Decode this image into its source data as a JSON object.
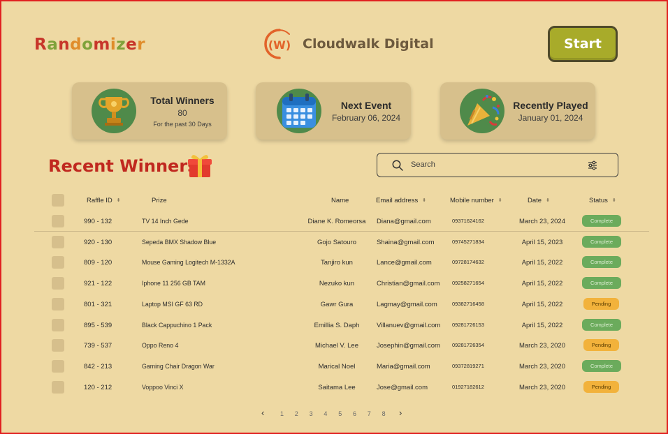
{
  "header": {
    "app_name_letters": [
      {
        "ch": "R",
        "color": "#c7362a"
      },
      {
        "ch": "a",
        "color": "#7fa23a"
      },
      {
        "ch": "n",
        "color": "#c7362a"
      },
      {
        "ch": "d",
        "color": "#e08d2b"
      },
      {
        "ch": "o",
        "color": "#7fa23a"
      },
      {
        "ch": "m",
        "color": "#c7362a"
      },
      {
        "ch": "i",
        "color": "#e08d2b"
      },
      {
        "ch": "z",
        "color": "#7fa23a"
      },
      {
        "ch": "e",
        "color": "#c7362a"
      },
      {
        "ch": "r",
        "color": "#e08d2b"
      }
    ],
    "brand_mark": "(W)",
    "brand_name": "Cloudwalk Digital",
    "start_label": "Start"
  },
  "cards": [
    {
      "title": "Total Winners",
      "value": "80",
      "sub": "For the past 30 Days",
      "icon": "trophy-icon"
    },
    {
      "title": "Next Event",
      "value": "February 06, 2024",
      "icon": "calendar-icon"
    },
    {
      "title": "Recently Played",
      "value": "January 01, 2024",
      "icon": "party-popper-icon"
    }
  ],
  "section": {
    "title": "Recent Winners",
    "icon": "gift-icon"
  },
  "search": {
    "placeholder": "Search"
  },
  "table": {
    "headers": [
      "Raffle ID",
      "Prize",
      "Name",
      "Email address",
      "Mobile number",
      "Date",
      "Status"
    ],
    "rows": [
      [
        "990 - 132",
        "TV 14 Inch Gede",
        "Diane K. Romeorsa",
        "Diana@gmail.com",
        "09371624162",
        "March 23, 2024",
        "Complete"
      ],
      [
        "920 - 130",
        "Sepeda BMX Shadow Blue",
        "Gojo Satouro",
        "Shaina@gmail.com",
        "09745271834",
        "April 15, 2023",
        "Complete"
      ],
      [
        "809 - 120",
        "Mouse Gaming Logitech M-1332A",
        "Tanjiro kun",
        "Lance@gmail.com",
        "09728174632",
        "April 15, 2022",
        "Complete"
      ],
      [
        "921 - 122",
        "Iphone 11 256 GB TAM",
        "Nezuko kun",
        "Christian@gmail.com",
        "09258271654",
        "April 15, 2022",
        "Complete"
      ],
      [
        "801 - 321",
        "Laptop MSI GF 63 RD",
        "Gawr Gura",
        "Lagmay@gmail.com",
        "09382716458",
        "April 15, 2022",
        "Pending"
      ],
      [
        "895 - 539",
        "Black Cappuchino 1 Pack",
        "Emillia S. Daph",
        "Villanuev@gmail.com",
        "09281726153",
        "April 15, 2022",
        "Complete"
      ],
      [
        "739 - 537",
        "Oppo Reno 4",
        "Michael V. Lee",
        "Josephin@gmail.com",
        "09281726354",
        "March 23, 2020",
        "Pending"
      ],
      [
        "842 - 213",
        "Gaming Chair Dragon War",
        "Marical Noel",
        "Maria@gmail.com",
        "09372819271",
        "March 23, 2020",
        "Complete"
      ],
      [
        "120 - 212",
        "Voppoo Vinci X",
        "Saitama Lee",
        "Jose@gmail.com",
        "01927182612",
        "March 23, 2020",
        "Pending"
      ]
    ]
  },
  "pagination": {
    "pages": [
      "1",
      "2",
      "3",
      "4",
      "5",
      "6",
      "7",
      "8"
    ]
  },
  "colors": {
    "background": "#eed9a3",
    "accent_red": "#c0281f",
    "start_button": "#a8ab2a",
    "complete": "#6bab5c",
    "pending": "#f2b23b"
  }
}
